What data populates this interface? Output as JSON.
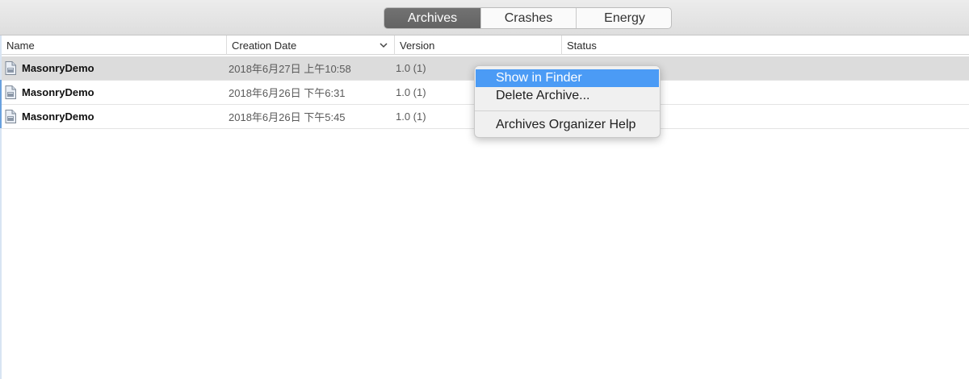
{
  "tabs": [
    {
      "label": "Archives",
      "active": true
    },
    {
      "label": "Crashes",
      "active": false
    },
    {
      "label": "Energy",
      "active": false
    }
  ],
  "table": {
    "columns": [
      "Name",
      "Creation Date",
      "Version",
      "Status"
    ],
    "sorted_column": "Creation Date",
    "rows": [
      {
        "name": "MasonryDemo",
        "date": "2018年6月27日 上午10:58",
        "version": "1.0 (1)",
        "status": ""
      },
      {
        "name": "MasonryDemo",
        "date": "2018年6月26日 下午6:31",
        "version": "1.0 (1)",
        "status": ""
      },
      {
        "name": "MasonryDemo",
        "date": "2018年6月26日 下午5:45",
        "version": "1.0 (1)",
        "status": ""
      }
    ]
  },
  "context_menu": {
    "items": [
      {
        "label": "Show in Finder",
        "highlighted": true
      },
      {
        "label": "Delete Archive...",
        "highlighted": false
      },
      {
        "label": "Archives Organizer Help",
        "highlighted": false
      }
    ]
  },
  "icons": {
    "file": "archive-file-icon",
    "sort": "chevron-down-icon"
  },
  "colors": {
    "accent": "#4b9bf5",
    "active_tab": "#6b6b6b",
    "selected_row": "#dcdcdc"
  }
}
